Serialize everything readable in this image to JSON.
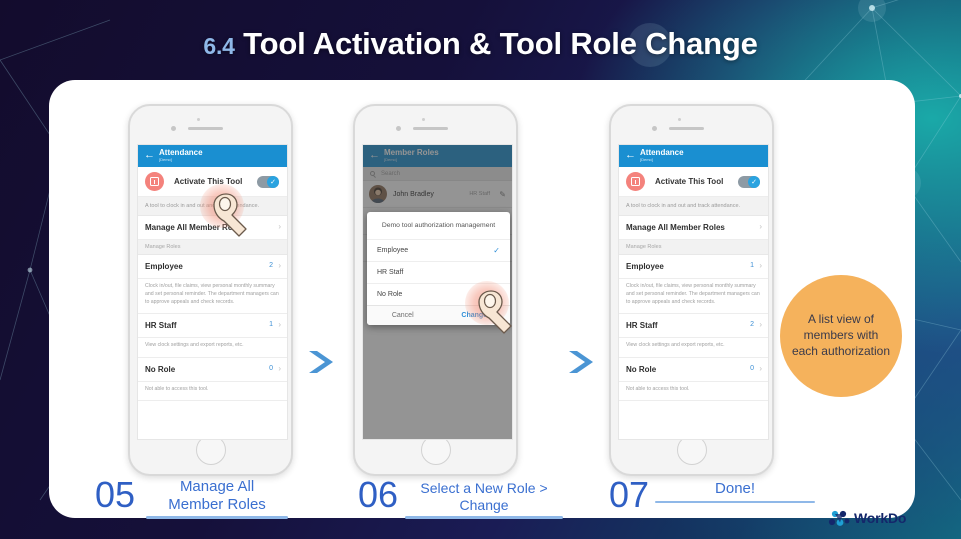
{
  "slide": {
    "section_number": "6.4",
    "title": "Tool Activation & Tool Role Change"
  },
  "colors": {
    "accent_blue": "#1a8fd1",
    "step_blue": "#2f5fc4",
    "callout_orange": "#f5b25c",
    "app_icon_pink": "#f4827c",
    "brand_navy": "#14276b"
  },
  "phone1": {
    "appbar": {
      "title": "Attendance",
      "subtitle": "[Demo]",
      "back_icon": "back-arrow-icon"
    },
    "activate": {
      "label": "Activate This Tool",
      "toggle_state": "on",
      "icon": "attendance-app-icon"
    },
    "tool_description": "A tool to clock in and out and track attendance.",
    "manage_all": {
      "label": "Manage All Member Roles",
      "chevron": "›"
    },
    "section_label": "Manage Roles",
    "roles": [
      {
        "name": "Employee",
        "count": "2",
        "chevron": "›",
        "description": "Clock in/out, file claims, view personal monthly summary and set personal reminder. The department managers can to approve appeals and check records."
      },
      {
        "name": "HR Staff",
        "count": "1",
        "chevron": "›",
        "description": "View clock settings and export reports, etc."
      },
      {
        "name": "No Role",
        "count": "0",
        "chevron": "›",
        "description": "Not able to access this tool."
      }
    ]
  },
  "phone2": {
    "appbar": {
      "title": "Member Roles",
      "subtitle": "[Demo]",
      "back_icon": "back-arrow-icon"
    },
    "search": {
      "placeholder": "Search",
      "icon": "search-icon"
    },
    "members": [
      {
        "name": "John Bradley",
        "role": "HR Staff",
        "edit_icon": "pencil-icon"
      },
      {
        "name": "",
        "role": "",
        "edit_icon": "pencil-icon"
      },
      {
        "name": "",
        "role": "",
        "edit_icon": "pencil-icon"
      }
    ],
    "dialog": {
      "title": "Demo tool authorization management",
      "options": [
        {
          "label": "Employee",
          "selected": true,
          "check_icon": "check-icon"
        },
        {
          "label": "HR Staff",
          "selected": false
        },
        {
          "label": "No Role",
          "selected": false
        }
      ],
      "cancel_label": "Cancel",
      "confirm_label": "Change"
    }
  },
  "phone3": {
    "appbar": {
      "title": "Attendance",
      "subtitle": "[Demo]",
      "back_icon": "back-arrow-icon"
    },
    "activate": {
      "label": "Activate This Tool",
      "toggle_state": "on",
      "icon": "attendance-app-icon"
    },
    "tool_description": "A tool to clock in and out and track attendance.",
    "manage_all": {
      "label": "Manage All Member Roles",
      "chevron": "›"
    },
    "section_label": "Manage Roles",
    "roles": [
      {
        "name": "Employee",
        "count": "1",
        "chevron": "›",
        "description": "Clock in/out, file claims, view personal monthly summary and set personal reminder. The department managers can to approve appeals and check records."
      },
      {
        "name": "HR Staff",
        "count": "2",
        "chevron": "›",
        "description": "View clock settings and export reports, etc."
      },
      {
        "name": "No Role",
        "count": "0",
        "chevron": "›",
        "description": "Not able to access this tool."
      }
    ]
  },
  "callout": {
    "text": "A list view of members with each authorization"
  },
  "steps": [
    {
      "number": "05",
      "caption": "Manage All\nMember Roles"
    },
    {
      "number": "06",
      "caption": "Select a New Role >\nChange"
    },
    {
      "number": "07",
      "caption": "Done!"
    }
  ],
  "brand": {
    "name": "WorkDo",
    "logo_icon": "workdo-logo-icon"
  }
}
